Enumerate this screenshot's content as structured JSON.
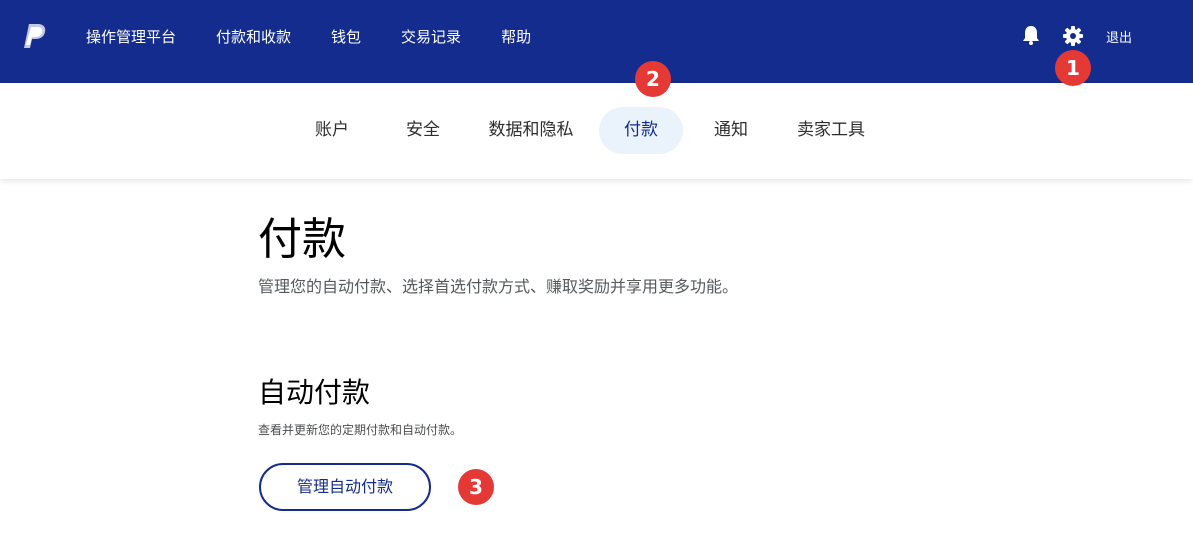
{
  "topbar": {
    "logo": "paypal-logo",
    "nav": [
      "操作管理平台",
      "付款和收款",
      "钱包",
      "交易记录",
      "帮助"
    ],
    "logout": "退出",
    "bg_color": "#142c8e"
  },
  "subnav": {
    "items": [
      "账户",
      "安全",
      "数据和隐私",
      "付款",
      "通知",
      "卖家工具"
    ],
    "active": "付款"
  },
  "badges": [
    "1",
    "2",
    "3"
  ],
  "page": {
    "title": "付款",
    "subtitle": "管理您的自动付款、选择首选付款方式、赚取奖励并享用更多功能。"
  },
  "section": {
    "title": "自动付款",
    "description": "查看并更新您的定期付款和自动付款。",
    "button": "管理自动付款"
  },
  "colors": {
    "badge": "#e53935",
    "accent": "#142c8e",
    "active_tab_bg": "#eaf3fc"
  }
}
